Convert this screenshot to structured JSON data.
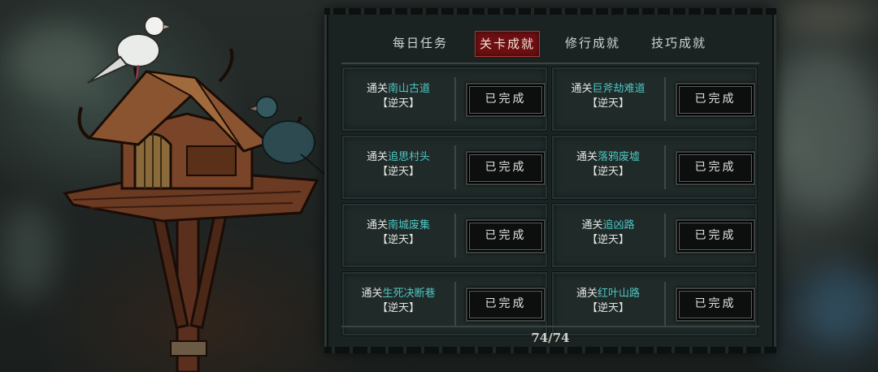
{
  "tabs": [
    {
      "label": "每日任务",
      "active": false
    },
    {
      "label": "关卡成就",
      "active": true
    },
    {
      "label": "修行成就",
      "active": false
    },
    {
      "label": "技巧成就",
      "active": false
    }
  ],
  "achievements": [
    {
      "prefix": "通关",
      "name": "南山古道",
      "difficulty": "【逆天】",
      "button": "已完成"
    },
    {
      "prefix": "通关",
      "name": "巨斧劫难道",
      "difficulty": "【逆天】",
      "button": "已完成"
    },
    {
      "prefix": "通关",
      "name": "追思村头",
      "difficulty": "【逆天】",
      "button": "已完成"
    },
    {
      "prefix": "通关",
      "name": "落鸦废墟",
      "difficulty": "【逆天】",
      "button": "已完成"
    },
    {
      "prefix": "通关",
      "name": "南城废集",
      "difficulty": "【逆天】",
      "button": "已完成"
    },
    {
      "prefix": "通关",
      "name": "追凶路",
      "difficulty": "【逆天】",
      "button": "已完成"
    },
    {
      "prefix": "通关",
      "name": "生死决断巷",
      "difficulty": "【逆天】",
      "button": "已完成"
    },
    {
      "prefix": "通关",
      "name": "红叶山路",
      "difficulty": "【逆天】",
      "button": "已完成"
    }
  ],
  "progress": "74/74",
  "colors": {
    "accent_tab": "#6e0f12",
    "stage_name": "#4ec7c2",
    "panel": "#1a2322"
  }
}
